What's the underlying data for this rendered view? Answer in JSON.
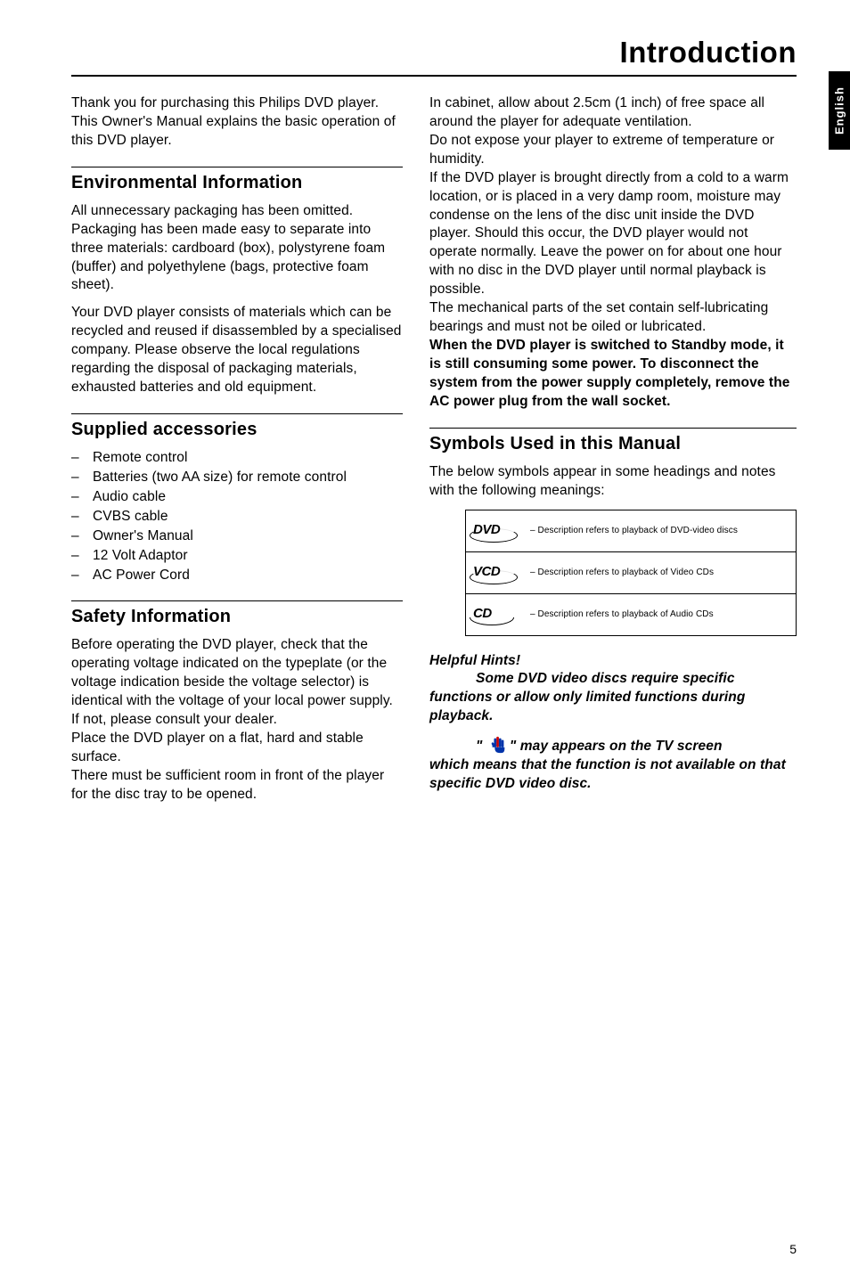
{
  "page_title": "Introduction",
  "side_tab": "English",
  "page_number": "5",
  "left": {
    "intro": "Thank you for purchasing this Philips DVD player. This Owner's Manual explains the basic operation of this DVD player.",
    "env_heading": "Environmental Information",
    "env_p1": "All unnecessary packaging has been omitted. Packaging has been made easy to separate into three materials: cardboard (box), polystyrene foam (buffer) and polyethylene (bags, protective foam sheet).",
    "env_p2": "Your DVD player consists of materials which can be recycled and reused if disassembled by a specialised company. Please observe the local regulations regarding the disposal of packaging materials, exhausted batteries and old equipment.",
    "supplied_heading": "Supplied accessories",
    "supplied_items": [
      "Remote control",
      "Batteries (two AA size) for remote control",
      "Audio cable",
      "CVBS cable",
      "Owner's Manual",
      "12 Volt Adaptor",
      "AC Power Cord"
    ],
    "safety_heading": "Safety Information",
    "safety_p1": "Before operating the DVD player, check that the operating voltage indicated on the typeplate (or the voltage indication beside the voltage selector) is identical with the voltage of your local power supply. If not, please consult your dealer.",
    "safety_p2": "Place the DVD player on a flat, hard and stable surface.",
    "safety_p3": "There must be sufficient room in front of the player for the disc tray to be opened."
  },
  "right": {
    "r_p1": "In cabinet, allow about 2.5cm (1 inch) of free space all around the player for adequate ventilation.",
    "r_p2": "Do not expose your player to extreme of temperature or humidity.",
    "r_p3": "If the DVD player is brought directly from a cold to a warm location, or is placed in a very damp room, moisture may condense on the lens of the disc unit inside the DVD player. Should this occur, the DVD player would not operate normally. Leave the power on for about one hour with no disc in the DVD player until normal playback is possible.",
    "r_p4": "The mechanical parts of the set contain self-lubricating bearings and must not be oiled or lubricated.",
    "r_bold": "When the DVD player is switched to Standby mode, it is still consuming some power.  To disconnect the system from the power supply completely, remove the AC power plug from the wall socket.",
    "symbols_heading": "Symbols Used in this Manual",
    "symbols_intro": "The below symbols appear in some headings and notes with the following meanings:",
    "symbols": [
      {
        "label": "DVD",
        "desc": "– Description refers to playback of DVD-video discs"
      },
      {
        "label": "VCD",
        "desc": "– Description refers to playback of Video CDs"
      },
      {
        "label": "CD",
        "desc": "– Description refers to playback of Audio CDs"
      }
    ],
    "hints_heading": "Helpful Hints!",
    "hints_p1": "Some DVD video discs require specific functions or allow only limited functions during playback.",
    "hints_quote_open": "\"",
    "hints_quote_close": "\"",
    "hints_p2a": " may appears on the TV screen",
    "hints_p3": "which means that the function is not available on that specific DVD video disc."
  }
}
